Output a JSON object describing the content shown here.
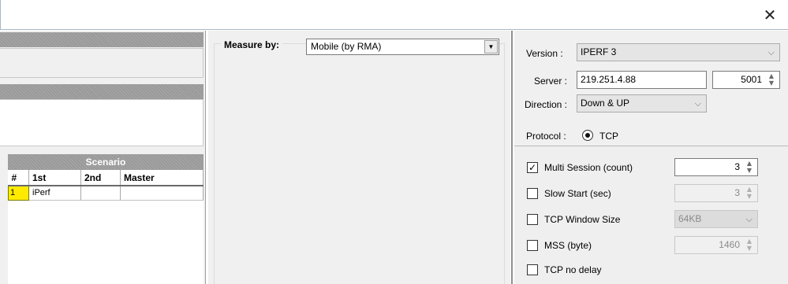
{
  "window": {
    "close_symbol": "✕"
  },
  "scenario": {
    "title": "Scenario",
    "columns": [
      "#",
      "1st",
      "2nd",
      "Master"
    ],
    "rows": [
      {
        "num": "1",
        "first": "iPerf",
        "second": "",
        "master": ""
      }
    ]
  },
  "measure": {
    "label": "Measure by:",
    "value": "Mobile (by RMA)",
    "arrow": "▼"
  },
  "settings": {
    "version_label": "Version :",
    "version_value": "IPERF 3",
    "server_label": "Server :",
    "server_value": "219.251.4.88",
    "port_value": "5001",
    "direction_label": "Direction :",
    "direction_value": "Down & UP",
    "protocol_label": "Protocol :",
    "protocol_value": "TCP",
    "chevron": "⌵",
    "spin_up": "▲",
    "spin_down": "▼"
  },
  "options": [
    {
      "label": "Multi Session (count)",
      "checked": true,
      "check_mark": "✓",
      "value": "3",
      "enabled": true
    },
    {
      "label": "Slow Start (sec)",
      "checked": false,
      "check_mark": "",
      "value": "3",
      "enabled": false
    },
    {
      "label": "TCP Window Size",
      "checked": false,
      "check_mark": "",
      "value": "64KB",
      "enabled": false
    },
    {
      "label": "MSS (byte)",
      "checked": false,
      "check_mark": "",
      "value": "1460",
      "enabled": false
    },
    {
      "label": "TCP no delay",
      "checked": false,
      "check_mark": ""
    }
  ]
}
